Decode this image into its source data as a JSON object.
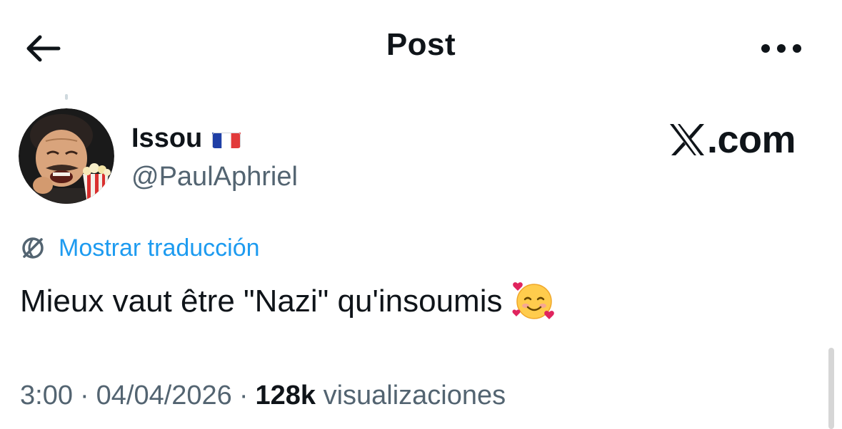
{
  "header": {
    "title": "Post",
    "back_icon": "arrow-left-icon",
    "more_icon": "more-horizontal-icon"
  },
  "author": {
    "name": "Issou",
    "flag_icon": "flag-france-icon",
    "handle": "@PaulAphriel",
    "avatar_icon": "avatar-icon"
  },
  "watermark": {
    "text": ".com",
    "logo_icon": "x-logo-icon"
  },
  "translation": {
    "label": "Mostrar traducción",
    "icon": "globe-icon"
  },
  "post": {
    "text": "Mieux vaut être \"Nazi\" qu'insoumis",
    "emoji_icon": "smiling-face-with-hearts-icon"
  },
  "meta": {
    "time": "3:00",
    "separator": "·",
    "date": "04/04/2026",
    "views_count": "128k",
    "views_label": "visualizaciones"
  },
  "colors": {
    "text": "#0f1419",
    "secondary": "#536471",
    "link": "#1d9bf0",
    "background": "#ffffff"
  }
}
